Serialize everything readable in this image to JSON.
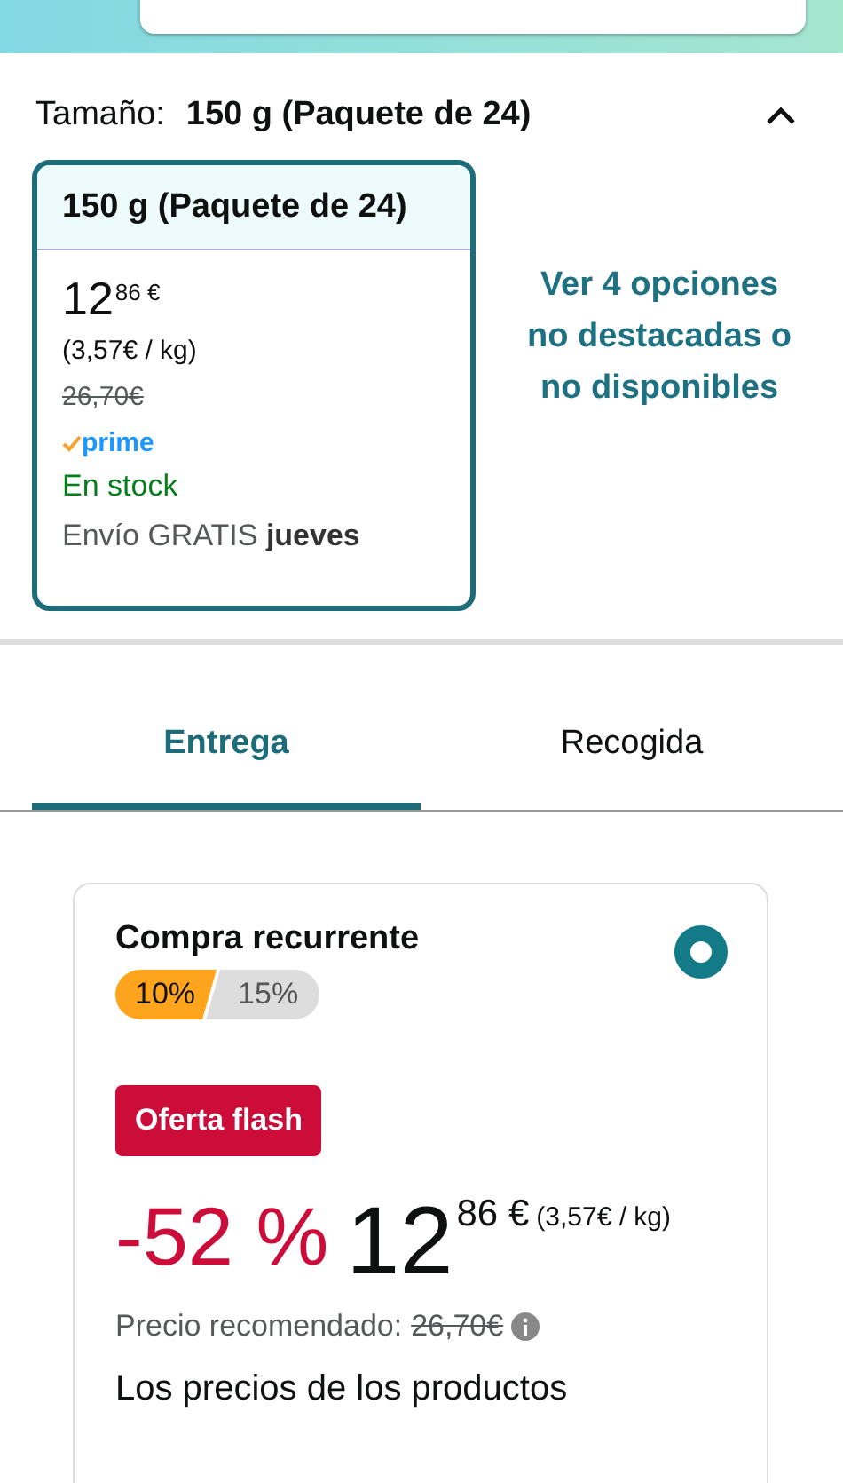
{
  "size_selector": {
    "label": "Tamaño:",
    "value": "150 g (Paquete de 24)",
    "expanded": true
  },
  "size_option": {
    "title": "150 g (Paquete de 24)",
    "price_whole": "12",
    "price_fraction": "86 €",
    "unit_price": "(3,57€ / kg)",
    "list_price": "26,70€",
    "prime": "prime",
    "availability": "En stock",
    "delivery": "Envío GRATIS **jueves**",
    "selected": true
  },
  "more_options_link": "Ver 4 opciones no destacadas o no disponibles",
  "tabs": [
    {
      "label": "Entrega",
      "selected": true
    },
    {
      "label": "Recogida",
      "selected": false
    }
  ],
  "offer": {
    "title": "Compra recurrente",
    "selected": true,
    "discounts": [
      {
        "label": "10%",
        "selected": true
      },
      {
        "label": "15%",
        "selected": false
      }
    ],
    "deal_badge": "Oferta flash",
    "discount": "-52 %",
    "price_whole": "12",
    "price_fraction": "86 €",
    "unit_price": "(3,57€ / kg)",
    "list_price_label": "Precio recomendado:",
    "list_price": "26,70€",
    "note": "Los precios de los productos"
  }
}
